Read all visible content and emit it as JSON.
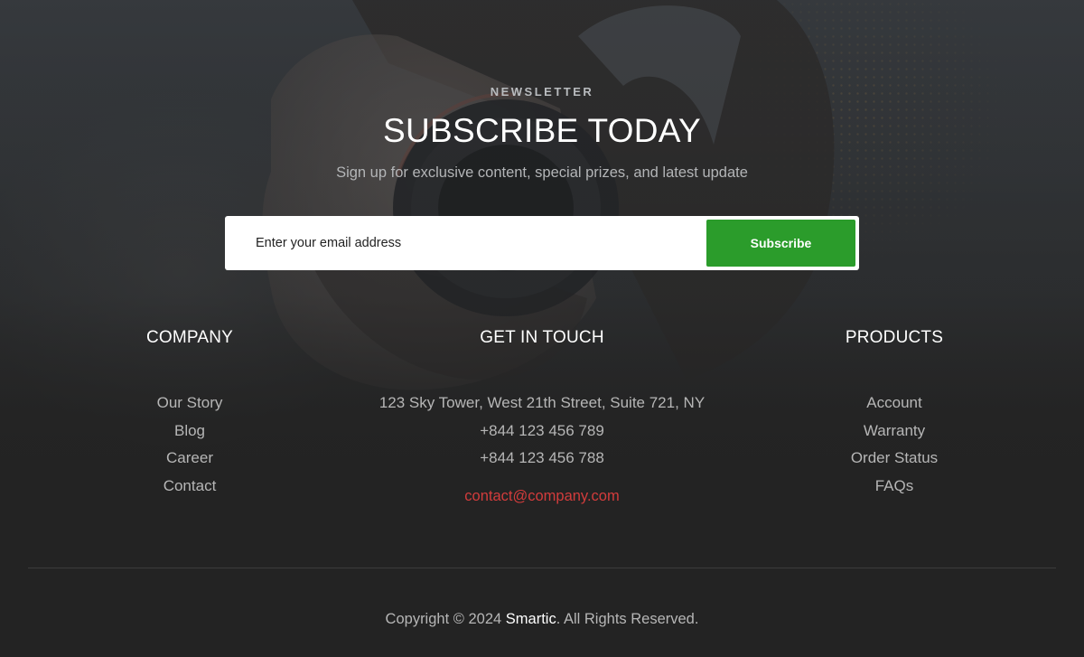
{
  "newsletter": {
    "eyebrow": "NEWSLETTER",
    "title": "SUBSCRIBE TODAY",
    "subtitle": "Sign up for exclusive content, special prizes, and latest update",
    "email_placeholder": "Enter your email address",
    "email_value": "",
    "button_label": "Subscribe"
  },
  "footer": {
    "company": {
      "heading": "COMPANY",
      "links": [
        "Our Story",
        "Blog",
        "Career",
        "Contact"
      ]
    },
    "touch": {
      "heading": "GET IN TOUCH",
      "address": "123 Sky Tower, West 21th Street, Suite 721, NY",
      "phone1": "+844 123 456 789",
      "phone2": "+844 123 456 788",
      "email": "contact@company.com"
    },
    "products": {
      "heading": "PRODUCTS",
      "links": [
        "Account",
        "Warranty",
        "Order Status",
        "FAQs"
      ]
    },
    "copyright": {
      "prefix": "Copyright © 2024 ",
      "brand": "Smartic",
      "suffix": ". All Rights Reserved."
    }
  },
  "background": {
    "image_subject": "person-with-headphones-photo"
  },
  "colors": {
    "accent_green": "#2b9c2b",
    "link_red": "#d33c3c",
    "footer_bg": "#232323",
    "text_muted": "#b6b6b6"
  }
}
